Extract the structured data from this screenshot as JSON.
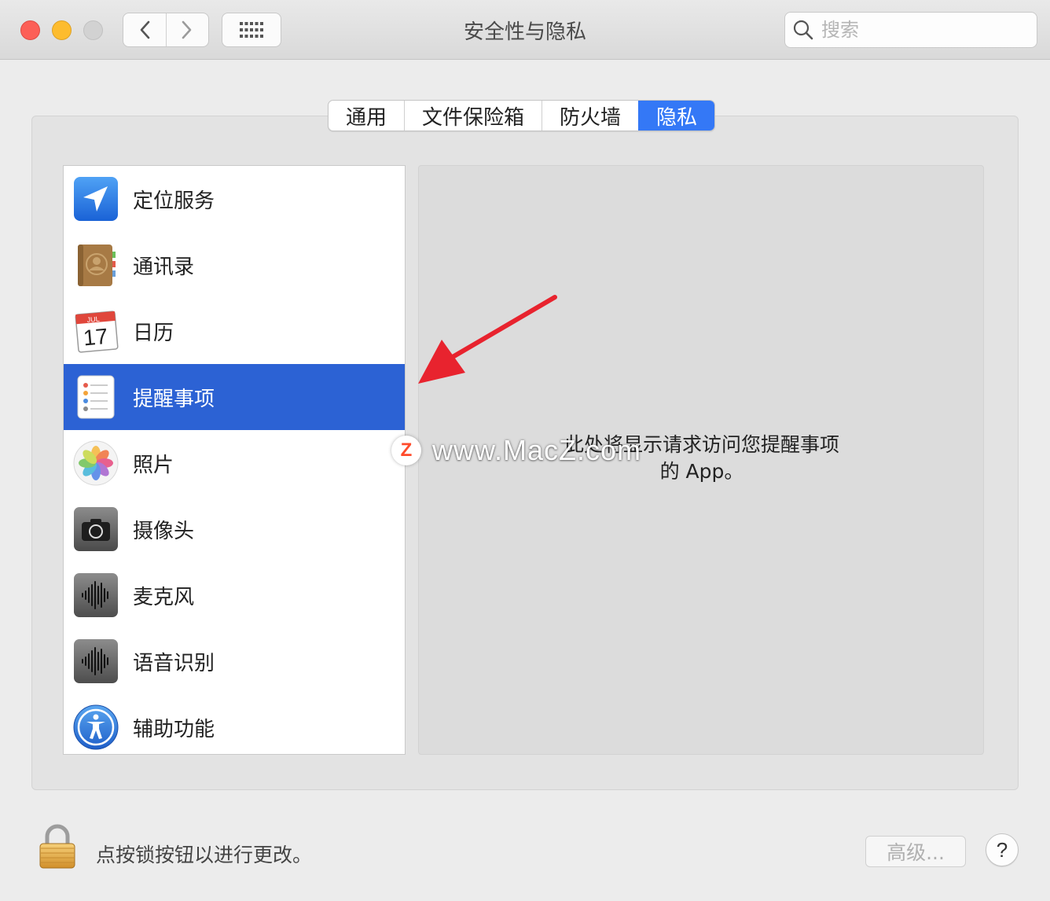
{
  "window": {
    "title": "安全性与隐私",
    "search_placeholder": "搜索"
  },
  "tabs": [
    {
      "label": "通用",
      "active": false
    },
    {
      "label": "文件保险箱",
      "active": false
    },
    {
      "label": "防火墙",
      "active": false
    },
    {
      "label": "隐私",
      "active": true
    }
  ],
  "privacy_list": [
    {
      "label": "定位服务",
      "icon": "location-arrow-icon"
    },
    {
      "label": "通讯录",
      "icon": "contacts-book-icon"
    },
    {
      "label": "日历",
      "icon": "calendar-icon"
    },
    {
      "label": "提醒事项",
      "icon": "reminders-icon",
      "selected": true
    },
    {
      "label": "照片",
      "icon": "photos-icon"
    },
    {
      "label": "摄像头",
      "icon": "camera-icon"
    },
    {
      "label": "麦克风",
      "icon": "microphone-waveform-icon"
    },
    {
      "label": "语音识别",
      "icon": "speech-waveform-icon"
    },
    {
      "label": "辅助功能",
      "icon": "accessibility-icon"
    }
  ],
  "calendar_icon": {
    "month": "JUL",
    "day": "17"
  },
  "detail": {
    "message_line1": "此处将显示请求访问您提醒事项",
    "message_line2": "的 App。"
  },
  "watermark": {
    "logo_letter": "Z",
    "text": "www.MacZ.com"
  },
  "footer": {
    "lock_text": "点按锁按钮以进行更改。",
    "advanced_label": "高级...",
    "help_label": "?"
  },
  "colors": {
    "selection": "#2c62d4",
    "tab_active": "#3478f6",
    "annotation_arrow": "#e8232e"
  }
}
